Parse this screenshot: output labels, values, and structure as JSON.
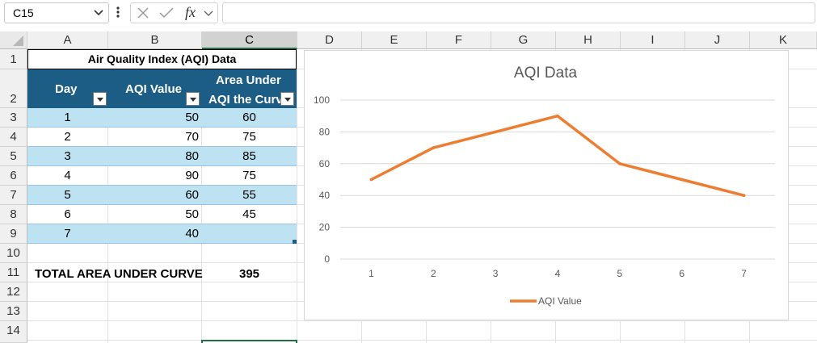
{
  "formula_bar": {
    "name_box": "C15",
    "fx_label": "fx",
    "formula": ""
  },
  "columns": [
    "A",
    "B",
    "C",
    "D",
    "E",
    "F",
    "G",
    "H",
    "I",
    "J",
    "K"
  ],
  "selected_column": "C",
  "rows": [
    "1",
    "2",
    "3",
    "4",
    "5",
    "6",
    "7",
    "8",
    "9",
    "10",
    "11",
    "12",
    "13",
    "14"
  ],
  "table": {
    "title": "Air Quality Index (AQI) Data",
    "headers": {
      "day": "Day",
      "aqi": "AQI Value",
      "area_line1": "Area Under",
      "area_line2": "AQI the Curv"
    },
    "rows": [
      {
        "day": "1",
        "aqi": "50",
        "area": "60"
      },
      {
        "day": "2",
        "aqi": "70",
        "area": "75"
      },
      {
        "day": "3",
        "aqi": "80",
        "area": "85"
      },
      {
        "day": "4",
        "aqi": "90",
        "area": "75"
      },
      {
        "day": "5",
        "aqi": "60",
        "area": "55"
      },
      {
        "day": "6",
        "aqi": "50",
        "area": "45"
      },
      {
        "day": "7",
        "aqi": "40",
        "area": ""
      }
    ],
    "total_label": "TOTAL AREA UNDER CURVE",
    "total_value": "395"
  },
  "chart_data": {
    "type": "line",
    "title": "AQI Data",
    "categories": [
      "1",
      "2",
      "3",
      "4",
      "5",
      "6",
      "7"
    ],
    "series": [
      {
        "name": "AQI Value",
        "values": [
          50,
          70,
          80,
          90,
          60,
          50,
          40
        ],
        "color": "#ed7d31"
      }
    ],
    "ylim": [
      0,
      100
    ],
    "yticks": [
      0,
      20,
      40,
      60,
      80,
      100
    ],
    "grid": true,
    "legend": "bottom"
  },
  "colors": {
    "header_fill": "#1c5d85",
    "band_fill": "#bde3f3",
    "selection_green": "#1e7145",
    "series_orange": "#ed7d31"
  }
}
